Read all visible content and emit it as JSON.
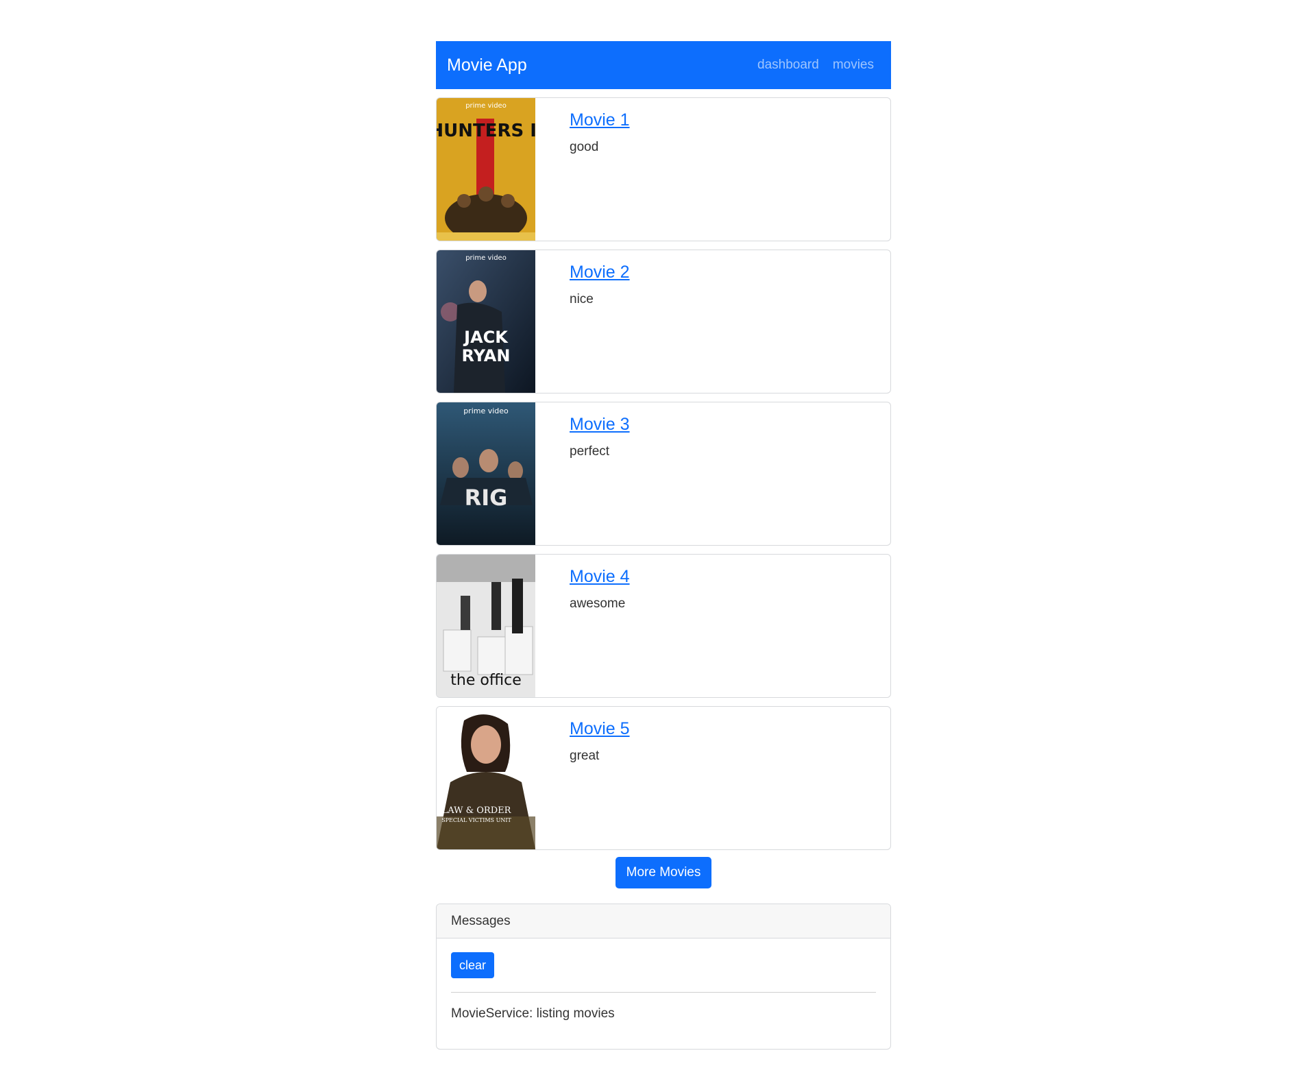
{
  "navbar": {
    "brand": "Movie App",
    "links": [
      "dashboard",
      "movies"
    ],
    "color": "#0d6efd"
  },
  "movies": [
    {
      "title": "Movie 1",
      "description": "good",
      "poster_text": "HUNTERS II",
      "poster_sub": "prime video"
    },
    {
      "title": "Movie 2",
      "description": "nice",
      "poster_text": "JACK RYAN",
      "poster_sub": "prime video"
    },
    {
      "title": "Movie 3",
      "description": "perfect",
      "poster_text": "THE RIG",
      "poster_sub": "prime video"
    },
    {
      "title": "Movie 4",
      "description": "awesome",
      "poster_text": "the office",
      "poster_sub": ""
    },
    {
      "title": "Movie 5",
      "description": "great",
      "poster_text": "LAW & ORDER",
      "poster_sub": "SPECIAL VICTIMS UNIT"
    }
  ],
  "more_button": "More Movies",
  "messages": {
    "header": "Messages",
    "clear_label": "clear",
    "items": [
      "MovieService: listing movies"
    ]
  }
}
